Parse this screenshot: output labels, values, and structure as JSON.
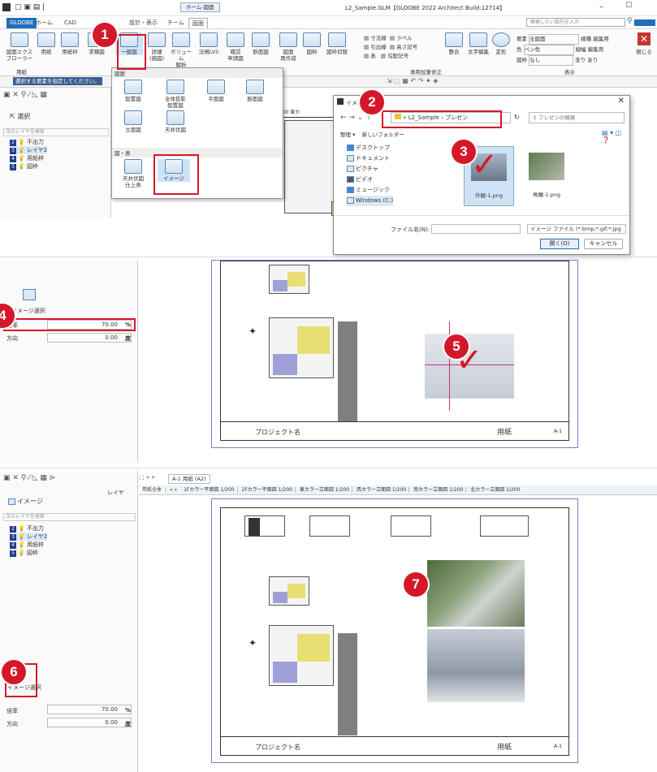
{
  "title_bar": {
    "title": "L2_Sample.GLM【GLOOBE 2022 Architect Build:12714】",
    "contextual_tab": "ホーム-図面"
  },
  "tabs": [
    "GLOOBE",
    "ホーム",
    "CAD",
    "設計・表示",
    "チーム",
    "図面"
  ],
  "search_placeholder": "検索したい語句を入力",
  "ribbon": {
    "buttons": [
      "図面エクスプローラー",
      "用紙",
      "用紙枠",
      "求積図",
      "一般図",
      "詳細\n(施図)",
      "ボリューム\n解析",
      "法規LVS",
      "確認\n申請図",
      "断面図",
      "図面\n再作成",
      "図枠",
      "図枠切替",
      "寸法線",
      "ラベル",
      "引出線",
      "高さ記号",
      "表",
      "勾配記号",
      "整合",
      "文字編集",
      "変形"
    ],
    "groups": [
      "用紙",
      "専用加筆修正",
      "表示"
    ],
    "right": {
      "elem_label": "要素",
      "elem_value": "全図面",
      "color_label": "色",
      "color_value": "ペン色",
      "frame_label": "図枠",
      "frame_value": "なし",
      "lt_label": "線種",
      "lt_value": "編集用",
      "lw_label": "線幅",
      "lw_value": "編集用",
      "fill_label": "塗り",
      "fill_value": "あり",
      "close": "閉じる"
    }
  },
  "dropdown": {
    "section1": "図面",
    "items1": [
      "配置図",
      "全体投影\n配置図",
      "平面図",
      "断面図",
      "立面図",
      "天井伏図"
    ],
    "section2": "図・表",
    "items2": [
      "天井伏図\n仕上表",
      "イメージ"
    ]
  },
  "dialog": {
    "title": "イメージ...ク",
    "path": [
      "«",
      "L2_Sample",
      "›",
      "プレゼン"
    ],
    "search": "プレゼンの検索",
    "organize": "整理",
    "new_folder": "新しいフォルダー",
    "tree": [
      "デスクトップ",
      "ドキュメント",
      "ピクチャ",
      "ビデオ",
      "ミュージック",
      "Windows (C:)"
    ],
    "files": [
      "外観-1.png",
      "鳥瞰-1.png"
    ],
    "filename_label": "ファイル名(N):",
    "filter": "イメージ ファイル (*.bmp;*.gif;*.jpg",
    "open": "開く(O)",
    "cancel": "キャンセル"
  },
  "left_panel": {
    "select_label": "選択",
    "hint": "選択する要素を指定してください。",
    "layer_search": "次のレイヤを検索",
    "layers": [
      {
        "n": "2",
        "name": "不出力"
      },
      {
        "n": "3",
        "name": "レイヤ2"
      },
      {
        "n": "4",
        "name": "用紙枠"
      },
      {
        "n": "5",
        "name": "図枠"
      }
    ],
    "image_select": "イメージ選択",
    "image_label": "イメージ",
    "scale_label": "倍率",
    "scale_value": "70.00",
    "scale_unit": "%",
    "dir_label": "方向",
    "dir_value": "0.00",
    "dir_unit": "度",
    "layer_dd": "レイヤ"
  },
  "sheet": {
    "project": "プロジェクト名",
    "sheet_name": "用紙",
    "sheet_no": "A-1",
    "view_label": "1Fカラー平面図 1/200",
    "sheet_info": "1/200 東カ"
  },
  "doc_tabs": {
    "tab": "A-1 用紙 (A2)",
    "items": [
      "用紙全体",
      "1Fカラー平面図 1/200",
      "2Fカラー平面図 1/200",
      "東カラー立面図 1/200",
      "西カラー立面図 1/200",
      "南カラー立面図 1/200",
      "北カラー立面図 1/200"
    ]
  },
  "badges": [
    "1",
    "2",
    "3",
    "4",
    "5",
    "6",
    "7"
  ],
  "colors": {
    "accent": "#d4182a",
    "brand": "#1f6fb8"
  }
}
